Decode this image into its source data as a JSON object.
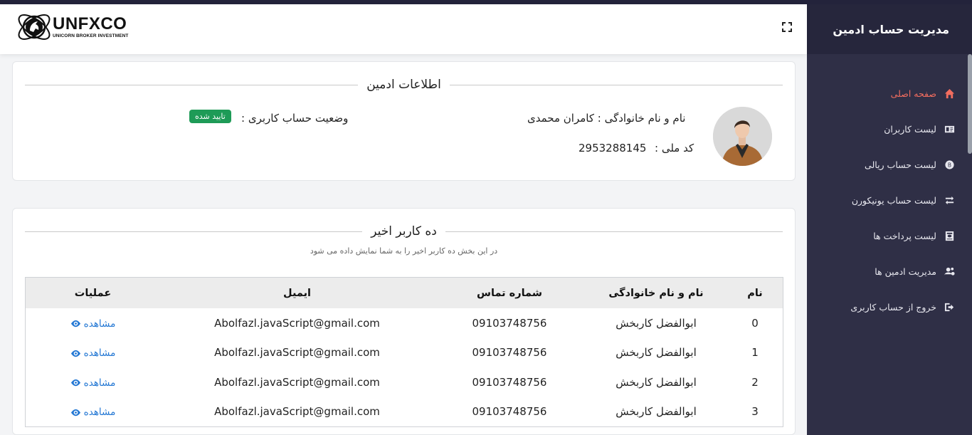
{
  "brand": {
    "name": "UNFXCO",
    "tagline": "UNICORN BROKER INVESTMENT"
  },
  "sidebar": {
    "title": "مدیریت حساب ادمین",
    "items": [
      {
        "label": "صفحه اصلی",
        "icon": "home-icon",
        "active": true
      },
      {
        "label": "لیست کاربران",
        "icon": "id-card-icon",
        "active": false
      },
      {
        "label": "لیست حساب ریالی",
        "icon": "coin-icon",
        "active": false
      },
      {
        "label": "لیست حساب یونیکورن",
        "icon": "exchange-icon",
        "active": false
      },
      {
        "label": "لیست پرداخت ها",
        "icon": "receipt-icon",
        "active": false
      },
      {
        "label": "مدیریت ادمین ها",
        "icon": "users-cog-icon",
        "active": false
      },
      {
        "label": "خروج از حساب کاربری",
        "icon": "logout-icon",
        "active": false
      }
    ]
  },
  "admin_info": {
    "title": "اطلاعات ادمین",
    "name_line": "نام و نام خانوادگی : کامران محمدی",
    "national_id_label": "کد ملی :",
    "national_id": "2953288145",
    "status_label": "وضعیت حساب کاربری :",
    "status_badge": "تایید شده"
  },
  "recent_users": {
    "title": "ده کاربر اخیر",
    "subtitle": "در این بخش ده کاربر اخیر را به شما نمایش داده می شود",
    "columns": [
      "نام",
      "نام و نام خانوادگی",
      "شماره تماس",
      "ایمیل",
      "عملیات"
    ],
    "rows": [
      {
        "index": "0",
        "full_name": "ابوالفضل کاربخش",
        "phone": "09103748756",
        "email": "Abolfazl.javaScript@gmail.com",
        "action": "مشاهده"
      },
      {
        "index": "1",
        "full_name": "ابوالفضل کاربخش",
        "phone": "09103748756",
        "email": "Abolfazl.javaScript@gmail.com",
        "action": "مشاهده"
      },
      {
        "index": "2",
        "full_name": "ابوالفضل کاربخش",
        "phone": "09103748756",
        "email": "Abolfazl.javaScript@gmail.com",
        "action": "مشاهده"
      },
      {
        "index": "3",
        "full_name": "ابوالفضل کاربخش",
        "phone": "09103748756",
        "email": "Abolfazl.javaScript@gmail.com",
        "action": "مشاهده"
      }
    ]
  },
  "colors": {
    "sidebar_bg": "#2f2f46",
    "active": "#f26d5f",
    "badge": "#1e9b57",
    "link": "#2478d4"
  }
}
